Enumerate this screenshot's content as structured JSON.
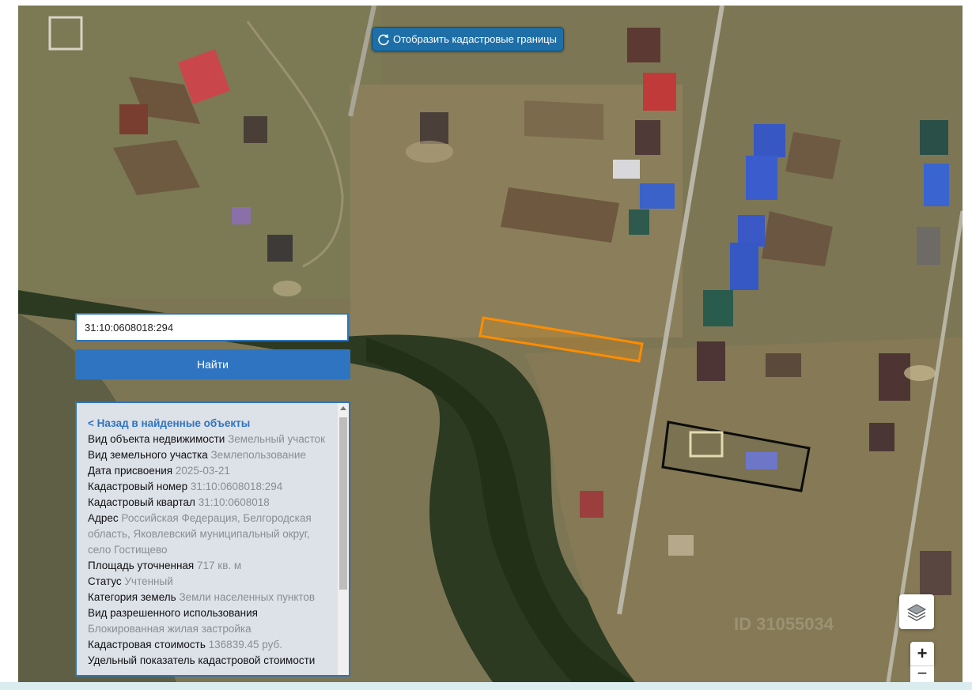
{
  "map": {
    "cadastral_button": {
      "label": "Отобразить кадастровые границы",
      "icon": "refresh-icon"
    },
    "watermark_text": "ID 31055034"
  },
  "search": {
    "value": "31:10:0608018:294",
    "find_label": "Найти"
  },
  "info": {
    "back_link": "< Назад в найденные объекты",
    "rows": [
      {
        "label": "Вид объекта недвижимости",
        "value": "Земельный участок"
      },
      {
        "label": "Вид земельного участка",
        "value": "Землепользование"
      },
      {
        "label": "Дата присвоения",
        "value": "2025-03-21"
      },
      {
        "label": "Кадастровый номер",
        "value": "31:10:0608018:294"
      },
      {
        "label": "Кадастровый квартал",
        "value": "31:10:0608018"
      },
      {
        "label": "Адрес",
        "value": "Российская Федерация, Белгородская область, Яковлевский муниципальный округ, село Гостищево"
      },
      {
        "label": "Площадь уточненная",
        "value": "717 кв. м"
      },
      {
        "label": "Статус",
        "value": "Учтенный"
      },
      {
        "label": "Категория земель",
        "value": "Земли населенных пунктов"
      },
      {
        "label": "Вид разрешенного использования",
        "value": "Блокированная жилая застройка"
      },
      {
        "label": "Кадастровая стоимость",
        "value": "136839.45 руб."
      },
      {
        "label": "Удельный показатель кадастровой стоимости",
        "value": ""
      }
    ]
  },
  "controls": {
    "layers_icon": "layers-icon",
    "zoom_in": "+",
    "zoom_out": "−"
  },
  "colors": {
    "accent": "#2f74c0",
    "parcel_outline": "#ff8c00",
    "panel_bg": "#dde1e8"
  }
}
